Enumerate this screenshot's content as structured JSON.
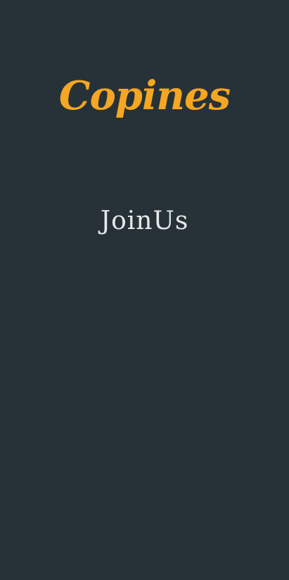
{
  "app": {
    "logo_text": "Copines",
    "join_label": "JoinUs"
  },
  "colors": {
    "background": "#263238",
    "brand": "#F5A623",
    "text": "#E8E8E8"
  }
}
